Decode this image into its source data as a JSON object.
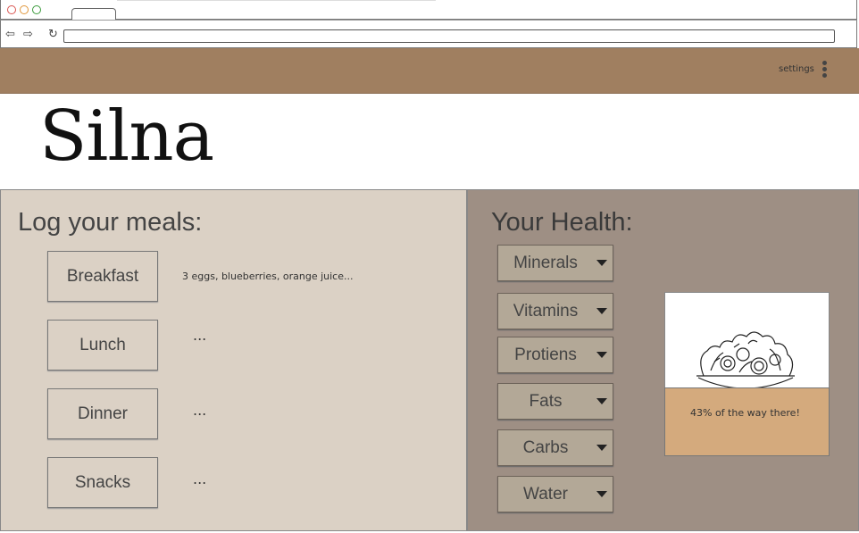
{
  "app": {
    "name": "Silna",
    "settings_label": "settings"
  },
  "meals": {
    "title": "Log your meals:",
    "items": [
      {
        "label": "Breakfast",
        "desc": "3 eggs, blueberries, orange juice..."
      },
      {
        "label": "Lunch",
        "desc": "..."
      },
      {
        "label": "Dinner",
        "desc": "..."
      },
      {
        "label": "Snacks",
        "desc": "..."
      }
    ]
  },
  "health": {
    "title": "Your Health:",
    "categories": [
      "Minerals",
      "Vitamins",
      "Protiens",
      "Fats",
      "Carbs",
      "Water"
    ],
    "progress_text": "43% of the way there!",
    "progress_fraction": 0.43
  },
  "icons": [
    "back-arrow-icon",
    "forward-arrow-icon",
    "reload-icon",
    "kebab-menu-icon",
    "caret-down-icon",
    "salad-bowl-icon"
  ],
  "colors": {
    "header": "#a07f60",
    "left_panel": "#dbd1c5",
    "right_panel": "#9e8f84",
    "progress_fill": "#d4aa7d"
  }
}
